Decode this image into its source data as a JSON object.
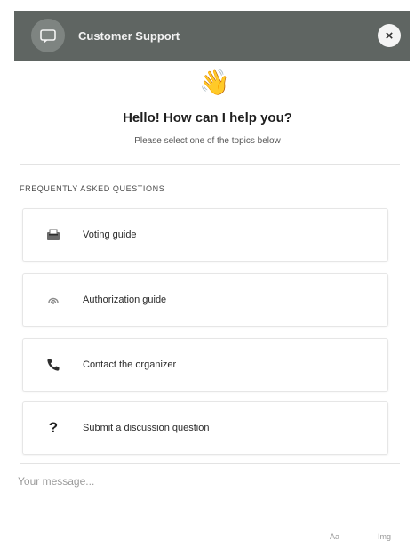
{
  "header": {
    "title": "Customer Support",
    "chat_icon": "chat-bubble-icon",
    "close_label": "×"
  },
  "wave_emoji": "👋",
  "greeting": "Hello! How can I help you?",
  "subtitle": "Please select one of the topics below",
  "faq": {
    "heading": "FREQUENTLY ASKED QUESTIONS",
    "items": [
      {
        "label": "Voting guide",
        "icon": "ballot-icon"
      },
      {
        "label": "Authorization guide",
        "icon": "fingerprint-icon"
      },
      {
        "label": "Contact the organizer",
        "icon": "phone-icon"
      },
      {
        "label": "Submit a discussion question",
        "icon": "question-mark-icon"
      }
    ]
  },
  "message": {
    "placeholder": "Your message...",
    "value": ""
  },
  "footer": {
    "format_label": "Aa",
    "image_label": "Img"
  }
}
